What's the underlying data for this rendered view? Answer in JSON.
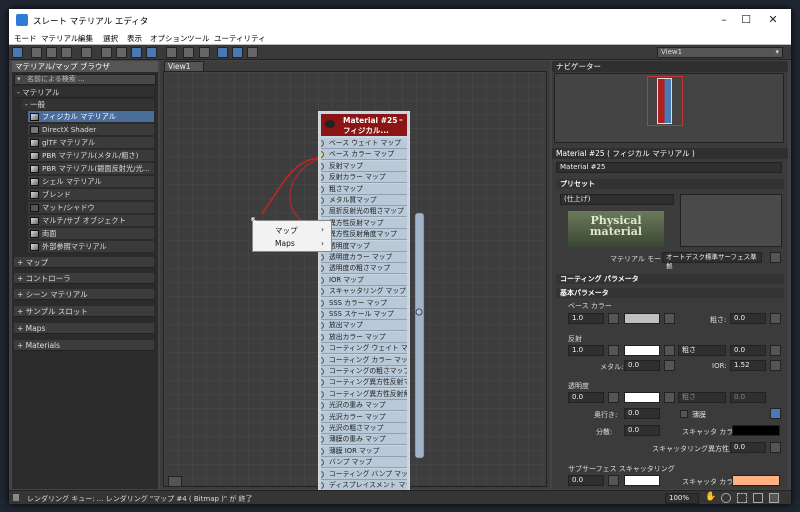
{
  "window": {
    "title": "スレート マテリアル エディタ"
  },
  "menu": [
    "モード",
    "マテリアル",
    "編集",
    "選択",
    "表示",
    "オプション",
    "ツール",
    "ユーティリティ"
  ],
  "toolbar": {
    "view_select": "View1"
  },
  "browser": {
    "title": "マテリアル/マップ ブラウザ",
    "search_placeholder": "名前による検索 ...",
    "materials_label": "- マテリアル",
    "general_label": "- 一般",
    "items": [
      "フィジカル マテリアル",
      "DirectX Shader",
      "glTF マテリアル",
      "PBR マテリアル(メタル/粗さ)",
      "PBR マテリアル(鏡面反射光/光...",
      "シェル マテリアル",
      "ブレンド",
      "マット/シャドウ",
      "マルチ/サブ オブジェクト",
      "両面",
      "外部参照マテリアル"
    ],
    "categories": [
      "+ マップ",
      "+ コントローラ",
      "+ シーン マテリアル",
      "+ サンプル スロット",
      "+ Maps",
      "+ Materials"
    ]
  },
  "view": {
    "tab": "View1"
  },
  "node": {
    "title": "Material #25",
    "subtitle": "フィジカル...",
    "ports": [
      "ベース ウェイト マップ",
      "ベース カラー マップ",
      "反射マップ",
      "反射カラー マップ",
      "粗さマップ",
      "メタル質マップ",
      "屈折反射光の粗さマップ",
      "異方性反射マップ",
      "異方性反射角度マップ",
      "透明度マップ",
      "透明度カラー マップ",
      "透明度の粗さマップ",
      "IOR マップ",
      "スキャッタリング マップ",
      "SSS カラー マップ",
      "SSS スケール マップ",
      "放出マップ",
      "放出カラー マップ",
      "コーティング ウェイト マップ",
      "コーティング カラー マップ",
      "コーティングの粗さマップ",
      "コーティング異方性反射マ...",
      "コーティング異方性反射角...",
      "光沢の重み マップ",
      "光沢カラー マップ",
      "光沢の粗さマップ",
      "薄膜の重み マップ",
      "薄膜 IOR マップ",
      "バンプ マップ",
      "コーティング バンプ マップ",
      "ディスプレイスメント マップ"
    ]
  },
  "context_menu": [
    "マップ",
    "Maps"
  ],
  "navigator": {
    "title": "ナビゲーター"
  },
  "params": {
    "header": "Material #25  ( フィジカル マテリアル )",
    "name": "Material #25",
    "presets_title": "プリセット",
    "preset_value": "(仕上げ)",
    "logo_line1": "Physical",
    "logo_line2": "material",
    "mode_label": "マテリアル モード:",
    "mode_value": "オートデスク標準サーフェス準拠",
    "coating_title": "コーティング パラメータ",
    "basic_title": "基本パラメータ",
    "base_color_label": "ベース カラー",
    "base_weight": "1.0",
    "roughness_label": "粗さ:",
    "roughness_val": "0.0",
    "reflection_label": "反射",
    "refl_weight": "1.0",
    "rough_mode": "粗さ",
    "refl_rough": "0.0",
    "metal_label": "メタル:",
    "metal_val": "0.0",
    "ior_label": "IOR:",
    "ior_val": "1.52",
    "transparency_label": "透明度",
    "trans_weight": "0.0",
    "trans_rough_mode": "粗さ",
    "trans_rough": "0.0",
    "depth_label": "奥行き:",
    "depth_val": "0.0",
    "thin_label": "薄膜",
    "disp_label": "分散:",
    "disp_val": "0.0",
    "scatter_color_label": "スキャッタ カラー:",
    "scatter_aniso_label": "スキャッタリング異方性反射:",
    "scatter_aniso_val": "0.0",
    "sss_title": "サブサーフェス スキャッタリング",
    "sss_weight": "0.0",
    "sss_color_label": "スキャッタ カラー:"
  },
  "status": {
    "text": "レンダリング キュー: ... レンダリング \"マップ #4 ( Bitmap )\" が 終了",
    "zoom": "100%"
  },
  "colors": {
    "accent": "#4a78b4",
    "node_header": "#8b1414",
    "base_color": "#bfbfbf",
    "refl_color": "#ffffff",
    "trans_color": "#ffffff",
    "scatter_color": "#000000",
    "sss_color": "#ffb27f"
  }
}
